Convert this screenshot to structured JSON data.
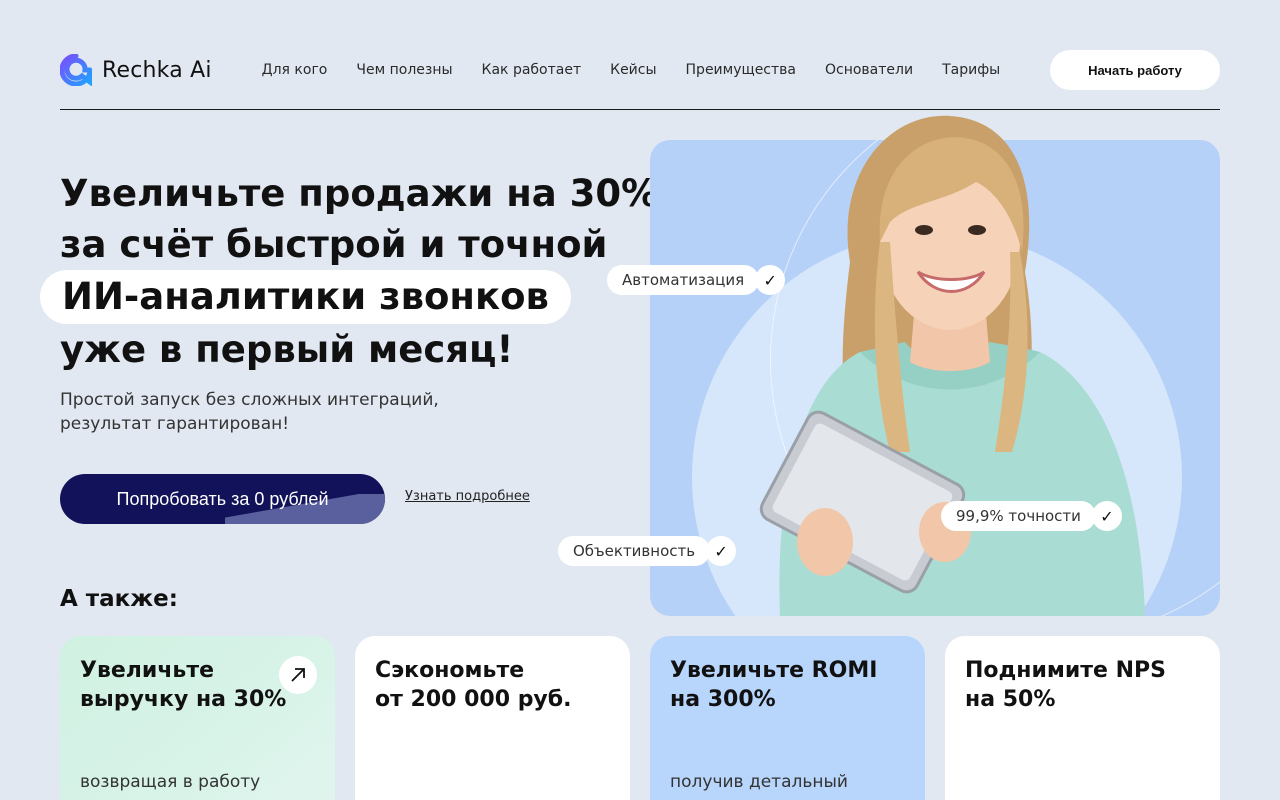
{
  "brand": {
    "name": "Rechka Ai",
    "accent": "#1f6bff"
  },
  "nav": {
    "items": [
      {
        "label": "Для кого"
      },
      {
        "label": "Чем полезны"
      },
      {
        "label": "Как работает"
      },
      {
        "label": "Кейсы"
      },
      {
        "label": "Преимущества"
      },
      {
        "label": "Основатели"
      },
      {
        "label": "Тарифы"
      }
    ],
    "cta_label": "Начать работу"
  },
  "hero": {
    "title_lines": [
      "Увеличьте продажи на 30%",
      "за счёт быстрой и точной",
      "ИИ-аналитики звонков",
      "уже в первый месяц!"
    ],
    "subtitle_lines": [
      "Простой запуск без сложных интеграций,",
      "результат гарантирован!"
    ],
    "primary_button": "Попробовать за 0 рублей",
    "secondary_link": "Узнать подробнее",
    "tags": [
      {
        "label": "Автоматизация",
        "icon": "check-icon"
      },
      {
        "label": "99,9% точности",
        "icon": "check-icon"
      },
      {
        "label": "Объективность",
        "icon": "check-icon"
      }
    ]
  },
  "also": {
    "title": "А также:",
    "cards": [
      {
        "title_lines": [
          "Увеличьте",
          "выручку на 30%"
        ],
        "subtitle": "возвращая в работу",
        "icon": "arrow-up-right-icon"
      },
      {
        "title_lines": [
          "Сэкономьте",
          "от 200 000 руб."
        ],
        "subtitle": ""
      },
      {
        "title_lines": [
          "Увеличьте ROMI",
          "на 300%"
        ],
        "subtitle": "получив детальный"
      },
      {
        "title_lines": [
          "Поднимите NPS",
          "на 50%"
        ],
        "subtitle": ""
      }
    ]
  },
  "colors": {
    "background": "#e2e8f2",
    "primary_button": "#12125a",
    "card_green": "#d0f1e2",
    "card_blue": "#b8d5fb",
    "photo_panel": "#b5d1f7"
  }
}
